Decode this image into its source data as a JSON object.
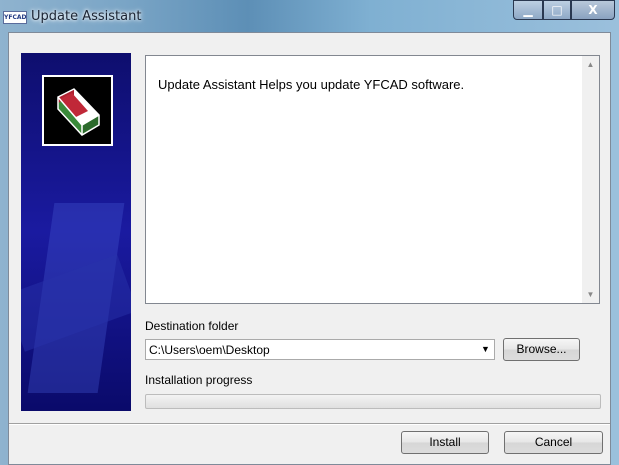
{
  "window": {
    "title": "Update Assistant",
    "icon_text": "YFCAD",
    "controls": {
      "minimize": "▁",
      "maximize": "□",
      "close": "X"
    }
  },
  "info": {
    "text": "Update Assistant Helps you update YFCAD software."
  },
  "destination": {
    "label": "Destination folder",
    "value": "C:\\Users\\oem\\Desktop",
    "browse_label": "Browse..."
  },
  "progress": {
    "label": "Installation progress",
    "value": 0
  },
  "footer": {
    "install_label": "Install",
    "cancel_label": "Cancel"
  }
}
